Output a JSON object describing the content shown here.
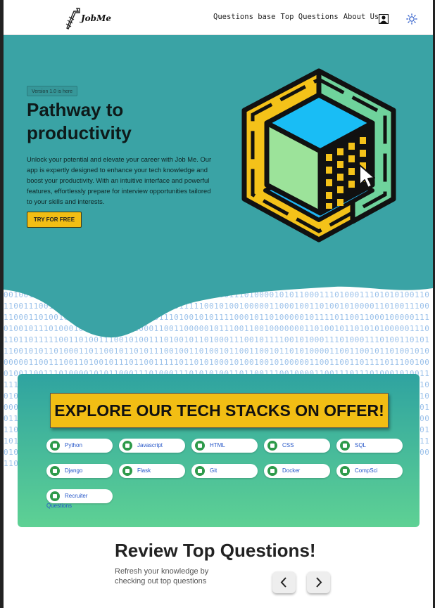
{
  "header": {
    "logo_text": "JobMe",
    "nav": [
      "Questions base",
      "Top Questions",
      "About Us"
    ]
  },
  "hero": {
    "badge": "Version 1.0 is here",
    "title": "Pathway to productivity",
    "description": "Unlock your potential and elevate your career with Job Me. Our app is expertly designed to enhance your tech knowledge and boost your productivity. With an intuitive interface and powerful features, effortlessly prepare for interview opportunities tailored to your skills and interests.",
    "cta_label": "TRY FOR FREE"
  },
  "binary_lines": [
    "0 1 1 0 0 1 0 1 1 0 1 0 1 0 0 0 0 1 1 0 0 1 1 0 0 1 0 1 1 0 1 0 0 1 0 1 0 0 0 0 0 0 1 1 0 0 1 1 1 0 0 1 1 0 1 0 0 1 0 1 1 1",
    "0 1 1 0 0 1 1 1 1 1 0 1 1 0 1 0 1 0 0 0 1 0 1 0 0 1 0 0 1 0 1 0 0 0 0 0 1 1 0 0 1 1 0 0 1 1 0 1 1 1 1 0 1 1 1 0 0 1 0 0 0 1",
    "0 0 1 1 0 0 1 1 1 0 1 0 0 0 0 1 0 1 0 1 1 0 0 0 1 1 1 0 1 0 0 0 1 1 1 0 1 0 1 0 1 0 0 1 1 0 1 1 0 0 1 1 1 0 0 1 0 0 0 0 1 1",
    "0 0 1 1 1 0 1 1 1 0 1 0 0 0 1 0 1 0 0 1 1 1 1 1 0 0 1 0 1 0 0 1 0 0 0 0 0 1 1 0 0 0 1 0 0 1 1 0 1 0 0 1 0 1 0 0 0 0 1 1 0 1",
    "0 0 1 1 1 0 0 1 1 0 0 0 1 1 0 1 0 0 1 0 0 1 1 1 0 1 1 0 1 1 0 0 1 0 0 0 1 0 1 1 1 0 1 0 0 1 0 1 0 1 1 1 1 0 0 0 1 0 1 1 0 1",
    "0 0 0 0 0 1 0 1 1 1 1 0 1 1 0 0 1 1 0 0 0 1 0 0 0 0 0 1 1 1 0 1 0 0 1 0 1 1 1 0 1 0 0 0 1 0 1 1 1 0 0 1 0 1 0 0 1 0 0 0 1 1",
    "0 0 1 1 0 0 0 0 0 1 0 1 1 1 0 0 1 1 0 0 1 0 0 0 0 0 0 0 1 1 0 1 0 0 1 0 1 1 0 1 0 1 0 1 0 0 0 0 0 1 1 1 0 1 1 0 1 1 0 1 1 1",
    "1 1 0 0 1 1 0 1 0 0 1 1 1 0 0 1 0 1 0 0 1 1 1 0 1 0 0 1 0 1 1 0 1 0 0 0 1 1 1 0 0 1 0 1 1 1 1 0 0 1 0 1 0 0 0 1 1 1 0 1 0 0",
    "0 1 1 1 0 1 0 0 1 1 0 1 0 1 1 1 0 0 1 0 1 0 1 1 0 1 0 0 0 1 1 0 1 1 0 0 1 0 1 1 0 1 0 1 1 1 0 0 1 0 0 1 1 0 1 0 0 1 0 1 1 0"
  ],
  "stacks": {
    "title": "EXPLORE OUR TECH STACKS ON OFFER!",
    "items": [
      "Python",
      "Javascript",
      "HTML",
      "CSS",
      "SQL",
      "Django",
      "Flask",
      "Git",
      "Docker",
      "CompSci",
      "Recruiter"
    ],
    "recruiter_extra": "Questions"
  },
  "review": {
    "title": "Review Top Questions!",
    "description": "Refresh your knowledge by checking out top questions"
  },
  "colors": {
    "hero_bg": "#3aa3a5",
    "accent_yellow": "#f2be14",
    "link_blue": "#2455c8",
    "icon_green": "#2e9a4a"
  },
  "icons": [
    "logo-icon",
    "user-icon",
    "sun-icon",
    "cube-illustration",
    "chevron-left-icon",
    "chevron-right-icon"
  ]
}
